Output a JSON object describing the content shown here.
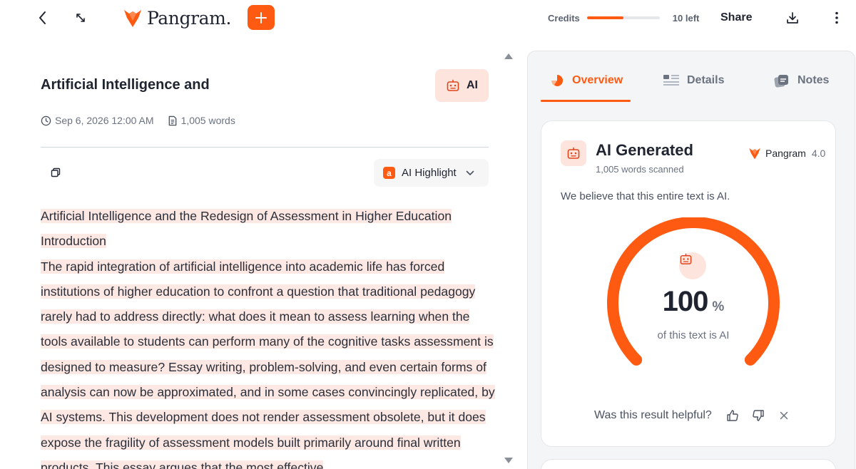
{
  "app": {
    "name": "Pangram.",
    "credits_label": "Credits",
    "credits_remaining_text": "10 left",
    "credits_remaining_fraction": 0.5,
    "share_label": "Share",
    "brand_color": "#ff5a12"
  },
  "document": {
    "title": "Artificial Intelligence and",
    "badge_label": "AI",
    "date": "Sep 6, 2026 12:00 AM",
    "word_count": "1,005 words",
    "highlight_mode": "AI Highlight",
    "highlight_mode_icon_letter": "a",
    "paragraphs": [
      "Artificial Intelligence and the Redesign of Assessment in Higher Education",
      "Introduction",
      "The rapid integration of artificial intelligence into academic life has forced institutions of higher education to confront a question that traditional pedagogy rarely had to address directly: what does it mean to assess learning when the tools available to students can perform many of the cognitive tasks assessment is designed to measure? Essay writing, problem-solving, and even certain forms of analysis can now be approximated, and in some cases convincingly replicated, by AI systems. This development does not render assessment obsolete, but it does expose the fragility of assessment models built primarily around final written products. This essay argues that the most effective"
    ]
  },
  "panel": {
    "tabs": [
      {
        "label": "Overview",
        "icon": "overview-icon",
        "active": true
      },
      {
        "label": "Details",
        "icon": "details-icon",
        "active": false
      },
      {
        "label": "Notes",
        "icon": "notes-icon",
        "active": false
      }
    ],
    "result": {
      "title": "AI Generated",
      "words_scanned": "1,005 words scanned",
      "model_name": "Pangram",
      "model_version": "4.0",
      "summary": "We believe that this entire text is AI.",
      "percent": "100",
      "percent_value": 100,
      "percent_unit": "%",
      "caption": "of this text is AI",
      "feedback_prompt": "Was this result helpful?"
    }
  }
}
